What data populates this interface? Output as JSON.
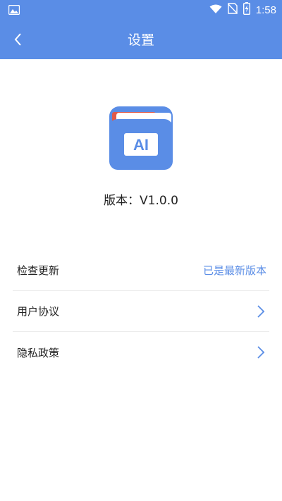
{
  "status_bar": {
    "time": "1:58",
    "icons": [
      "image-icon",
      "wifi-icon",
      "no-sim-icon",
      "battery-charging-icon"
    ]
  },
  "header": {
    "title": "设置",
    "back_icon": "chevron-left-icon"
  },
  "app": {
    "logo_text": "AI",
    "version_label": "版本：V1.0.0"
  },
  "settings": {
    "items": [
      {
        "label": "检查更新",
        "value": "已是最新版本"
      },
      {
        "label": "用户协议",
        "icon": "chevron-right-icon"
      },
      {
        "label": "隐私政策",
        "icon": "chevron-right-icon"
      }
    ]
  },
  "colors": {
    "accent": "#5a8de6",
    "divider": "#ececec"
  }
}
